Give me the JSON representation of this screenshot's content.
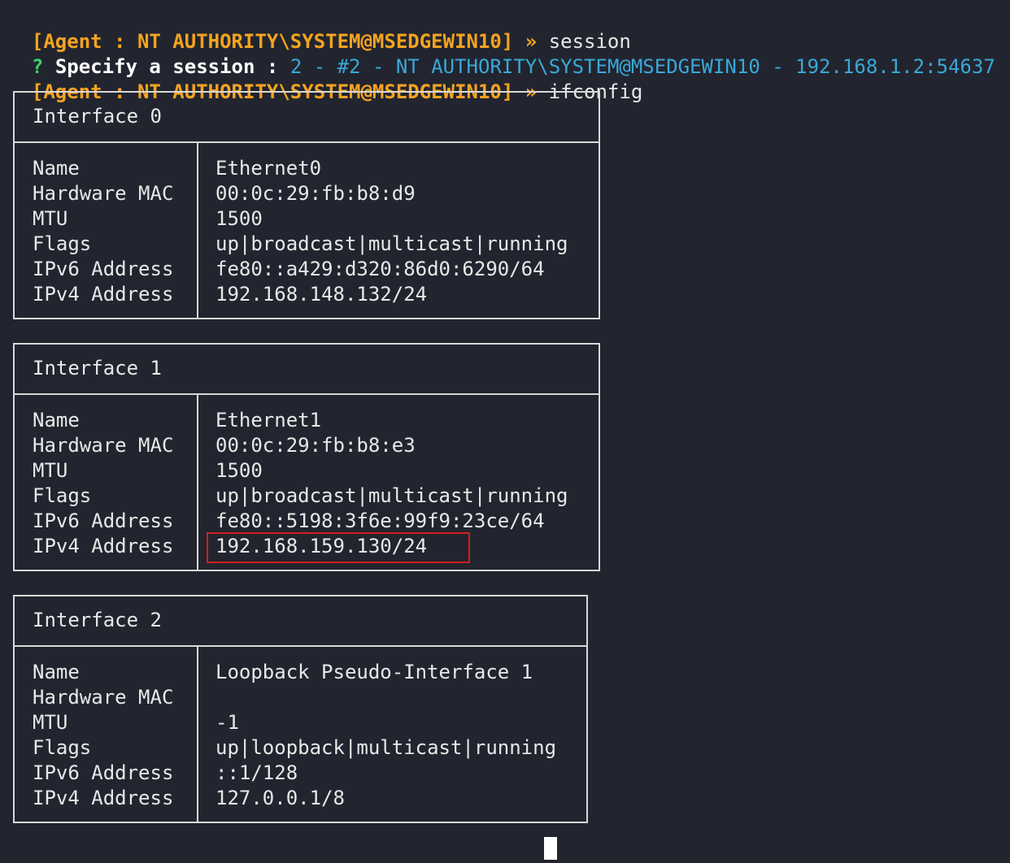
{
  "terminal": {
    "prompt": "[Agent : NT AUTHORITY\\SYSTEM@MSEDGEWIN10] »",
    "lines": [
      {
        "command": "session"
      },
      {
        "question_mark": "?",
        "question": "Specify a session :",
        "answer": "2 - #2 - NT AUTHORITY\\SYSTEM@MSEDGEWIN10 - 192.168.1.2:54637"
      },
      {
        "command": "ifconfig"
      }
    ],
    "interfaces": [
      {
        "title": "Interface 0",
        "keys": [
          "Name",
          "Hardware MAC",
          "MTU",
          "Flags",
          "IPv6 Address",
          "IPv4 Address"
        ],
        "values": [
          "Ethernet0",
          "00:0c:29:fb:b8:d9",
          "1500",
          "up|broadcast|multicast|running",
          "fe80::a429:d320:86d0:6290/64",
          "192.168.148.132/24"
        ]
      },
      {
        "title": "Interface 1",
        "keys": [
          "Name",
          "Hardware MAC",
          "MTU",
          "Flags",
          "IPv6 Address",
          "IPv4 Address"
        ],
        "values": [
          "Ethernet1",
          "00:0c:29:fb:b8:e3",
          "1500",
          "up|broadcast|multicast|running",
          "fe80::5198:3f6e:99f9:23ce/64",
          "192.168.159.130/24"
        ]
      },
      {
        "title": "Interface 2",
        "keys": [
          "Name",
          "Hardware MAC",
          "MTU",
          "Flags",
          "IPv6 Address",
          "IPv4 Address"
        ],
        "values": [
          "Loopback Pseudo-Interface 1",
          "",
          "-1",
          "up|loopback|multicast|running",
          "::1/128",
          "127.0.0.1/8"
        ]
      }
    ]
  },
  "colors": {
    "background": "#22252f",
    "prompt": "#f5a320",
    "question_mark": "#3fd36a",
    "answer": "#3aa8d8",
    "highlight_border": "#d21f1f"
  }
}
